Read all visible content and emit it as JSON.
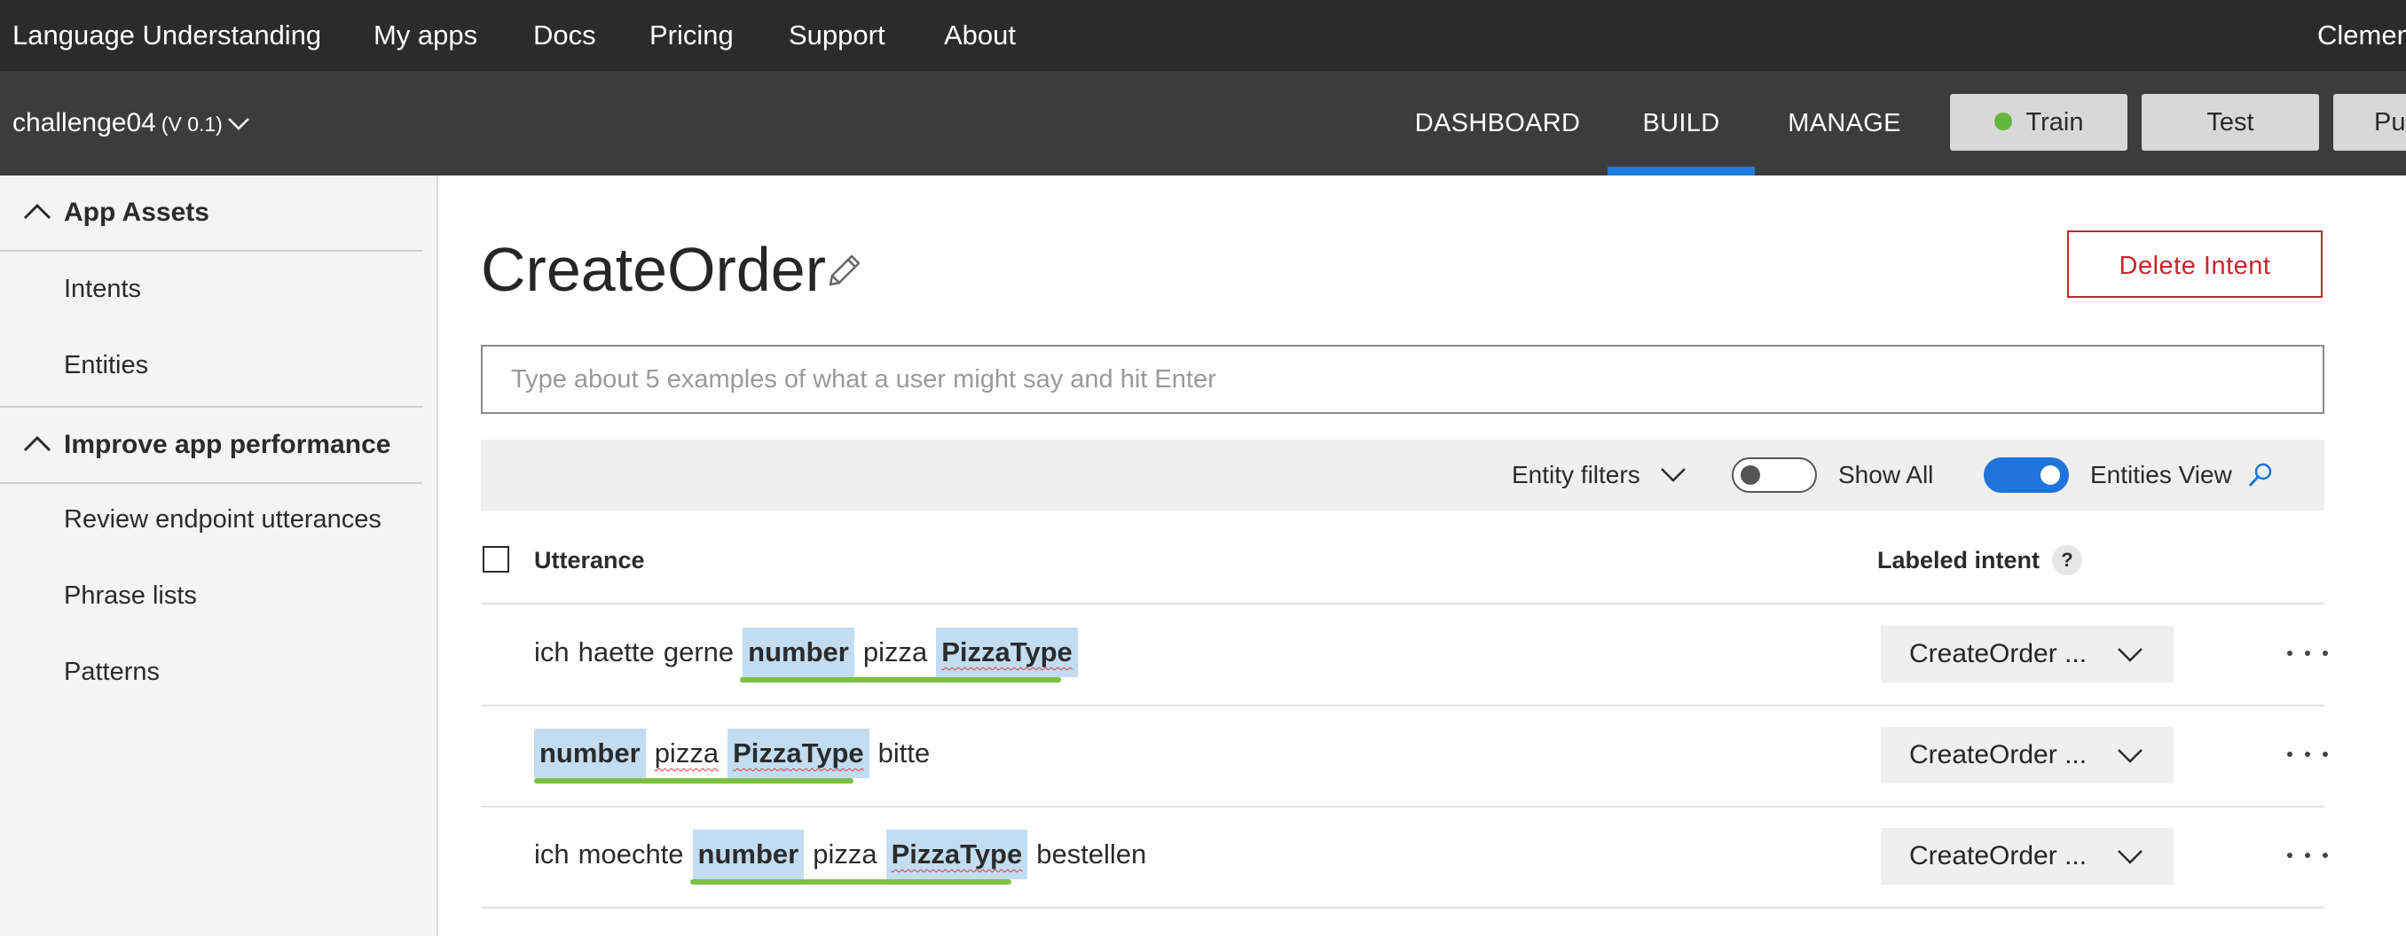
{
  "topnav": {
    "items": [
      "Language Understanding",
      "My apps",
      "Docs",
      "Pricing",
      "Support",
      "About"
    ],
    "user": "Clemen"
  },
  "appbar": {
    "app_name": "challenge04",
    "version": "(V 0.1)",
    "tabs": [
      "DASHBOARD",
      "BUILD",
      "MANAGE"
    ],
    "active_tab": "BUILD",
    "train_label": "Train",
    "test_label": "Test",
    "publish_label": "Pu"
  },
  "sidebar": {
    "sections": [
      {
        "label": "App Assets",
        "items": [
          "Intents",
          "Entities"
        ]
      },
      {
        "label": "Improve app performance",
        "items": [
          "Review endpoint utterances",
          "Phrase lists",
          "Patterns"
        ]
      }
    ]
  },
  "main": {
    "title": "CreateOrder",
    "delete_label": "Delete Intent",
    "input_placeholder": "Type about 5 examples of what a user might say and hit Enter",
    "filters": {
      "entity_filters_label": "Entity filters",
      "show_all_label": "Show All",
      "show_all_on": false,
      "entities_view_label": "Entities View",
      "entities_view_on": true
    },
    "table": {
      "col_utterance": "Utterance",
      "col_intent": "Labeled intent",
      "help": "?",
      "rows": [
        {
          "tokens": [
            "ich",
            "haette",
            "gerne",
            "number",
            "pizza",
            "PizzaType"
          ],
          "intent": "CreateOrder ..."
        },
        {
          "tokens": [
            "number",
            "pizza",
            "PizzaType",
            "bitte"
          ],
          "intent": "CreateOrder ..."
        },
        {
          "tokens": [
            "ich",
            "moechte",
            "number",
            "pizza",
            "PizzaType",
            "bestellen"
          ],
          "intent": "CreateOrder ..."
        }
      ]
    }
  },
  "colors": {
    "topnav_bg": "#2b2b2b",
    "appbar_bg": "#3c3c3c",
    "accent_blue": "#1e7ddf",
    "train_dot": "#64b73b",
    "delete_red": "#c4262e",
    "entity_bg": "#c2dcf1",
    "entity_line": "#7ac143"
  }
}
